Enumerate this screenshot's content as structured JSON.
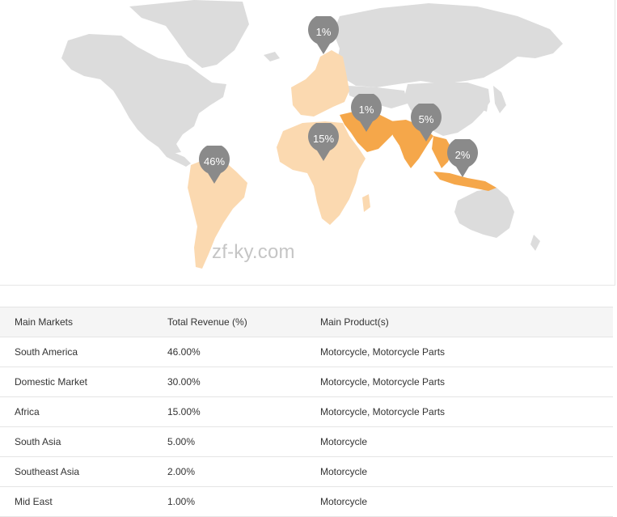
{
  "map": {
    "watermark": "zf-ky.com",
    "colors": {
      "land": "#dcdcdc",
      "light_market": "#fbd9b0",
      "dark_market": "#f5a74a",
      "pin": "#8a8a8a"
    },
    "pins": [
      {
        "label": "46%",
        "market": "South America"
      },
      {
        "label": "1%",
        "market": "Domestic Market"
      },
      {
        "label": "15%",
        "market": "Africa"
      },
      {
        "label": "1%",
        "market": "Mid East"
      },
      {
        "label": "5%",
        "market": "South Asia"
      },
      {
        "label": "2%",
        "market": "Southeast Asia"
      }
    ]
  },
  "table": {
    "headers": [
      "Main Markets",
      "Total Revenue (%)",
      "Main Product(s)"
    ],
    "rows": [
      {
        "market": "South America",
        "revenue": "46.00%",
        "products": "Motorcycle, Motorcycle Parts"
      },
      {
        "market": "Domestic Market",
        "revenue": "30.00%",
        "products": "Motorcycle, Motorcycle Parts"
      },
      {
        "market": "Africa",
        "revenue": "15.00%",
        "products": "Motorcycle, Motorcycle Parts"
      },
      {
        "market": "South Asia",
        "revenue": "5.00%",
        "products": "Motorcycle"
      },
      {
        "market": "Southeast Asia",
        "revenue": "2.00%",
        "products": "Motorcycle"
      },
      {
        "market": "Mid East",
        "revenue": "1.00%",
        "products": "Motorcycle"
      }
    ]
  }
}
